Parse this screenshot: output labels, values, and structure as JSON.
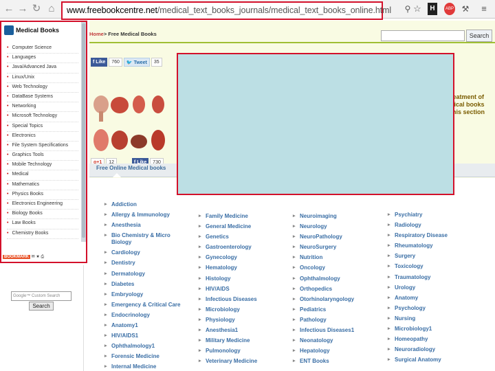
{
  "browser": {
    "url_domain": "www.freebookcentre.net",
    "url_path": "/medical_text_books_journals/medical_text_books_online.html",
    "back_icon": "arrow-left-icon",
    "forward_icon": "arrow-right-icon",
    "reload_icon": "reload-icon",
    "home_icon": "home-icon"
  },
  "sidebar": {
    "title": "Medical Books",
    "items": [
      "Computer Science",
      "Languages",
      "Java/Advanced Java",
      "Linux/Unix",
      "Web Technology",
      "DataBase Systems",
      "Networking",
      "Microsoft Technology",
      "Special Topics",
      "Electronics",
      "File System Specifications",
      "Graphics Tools",
      "Mobile Technology",
      "Medical",
      "Mathematics",
      "Physics Books",
      "Electronics Engineering",
      "Biology Books",
      "Law Books",
      "Chemistry Books"
    ],
    "bookmark": "BOOKMARK"
  },
  "google_search": {
    "placeholder": "Google™ Custom Search",
    "button": "Search"
  },
  "main": {
    "crumb_home": "Home",
    "crumb_rest": "> Free Medical Books",
    "search_button": "Search",
    "fb_like": "Like",
    "fb_count": "760",
    "tweet": "Tweet",
    "tweet_count": "35",
    "gplus": "g+1",
    "gplus_count": "12",
    "fb_like2": "Like",
    "fb_count2": "730",
    "intro_lines": [
      "reatment of",
      "dical books",
      "this section"
    ],
    "tab_label": "Free Online Medical books"
  },
  "columns": [
    [
      "Addiction",
      "Allergy & Immunology",
      "Anesthesia",
      "Bio Chemistry & Micro Biology",
      "Cardiology",
      "Dentistry",
      "Dermatology",
      "Diabetes",
      "Embryology",
      "Emergency & Critical Care",
      "Endocrinology",
      "Anatomy1",
      "HIV/AIDS1",
      "Ophthalmology1",
      "Forensic Medicine",
      "Internal Medicine"
    ],
    [
      "Family Medicine",
      "General Medicine",
      "Genetics",
      "Gastroenterology",
      "Gynecology",
      "Hematology",
      "Histology",
      "HIV/AIDS",
      "Infectious Diseases",
      "Microbiology",
      "Physiology",
      "Anesthesia1",
      "Military Medicine",
      "Pulmonology",
      "Veterinary Medicine"
    ],
    [
      "Neuroimaging",
      "Neurology",
      "NeuroPathology",
      "NeuroSurgery",
      "Nutrition",
      "Oncology",
      "Ophthalmology",
      "Orthopedics",
      "Otorhinolaryngology",
      "Pediatrics",
      "Pathology",
      "Infectious Diseases1",
      "Neonatology",
      "Hepatology",
      "ENT Books"
    ],
    [
      "Psychiatry",
      "Radiology",
      "Respiratory Disease",
      "Rheumatology",
      "Surgery",
      "Toxicology",
      "Traumatology",
      "Urology",
      "Anatomy",
      "Psychology",
      "Nursing",
      "Microbiology1",
      "Homeopathy",
      "Neuroradiology",
      "Surgical Anatomy"
    ]
  ]
}
